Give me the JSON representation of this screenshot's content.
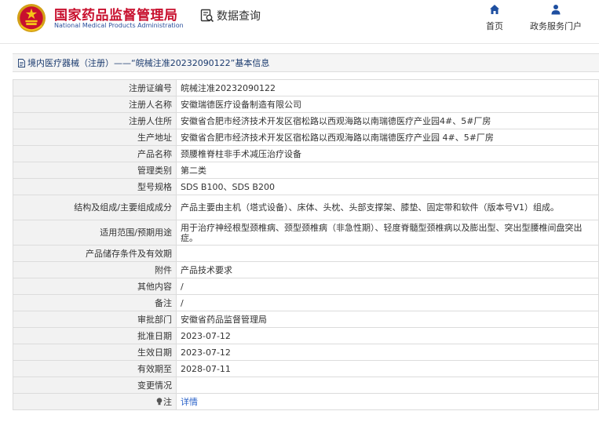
{
  "header": {
    "brand_cn": "国家药品监督管理局",
    "brand_en": "National Medical Products Administration",
    "search_label": "数据查询",
    "nav": [
      {
        "label": "首页",
        "icon": "home-icon"
      },
      {
        "label": "政务服务门户",
        "icon": "user-icon"
      }
    ],
    "colors": {
      "brand_red": "#c8102e",
      "brand_blue": "#2a4f9c",
      "nav_blue": "#1e4fa0"
    }
  },
  "breadcrumb": {
    "icon": "document-icon",
    "text": "境内医疗器械（注册）——“皖械注准20232090122”基本信息"
  },
  "rows": [
    {
      "label": "注册证编号",
      "value": "皖械注准20232090122"
    },
    {
      "label": "注册人名称",
      "value": "安徽瑞德医疗设备制造有限公司"
    },
    {
      "label": "注册人住所",
      "value": "安徽省合肥市经济技术开发区宿松路以西观海路以南瑞德医疗产业园4#、5#厂房"
    },
    {
      "label": "生产地址",
      "value": "安徽省合肥市经济技术开发区宿松路以西观海路以南瑞德医疗产业园 4#、5#厂房"
    },
    {
      "label": "产品名称",
      "value": "颈腰椎脊柱非手术减压治疗设备"
    },
    {
      "label": "管理类别",
      "value": "第二类"
    },
    {
      "label": "型号规格",
      "value": "SDS B100、SDS B200"
    },
    {
      "label": "结构及组成/主要组成成分",
      "value": "产品主要由主机（塔式设备）、床体、头枕、头部支撑架、膝垫、固定带和软件（版本号V1）组成。"
    },
    {
      "label": "适用范围/预期用途",
      "value": "用于治疗神经根型颈椎病、颈型颈椎病（非急性期）、轻度脊髓型颈椎病以及膨出型、突出型腰椎间盘突出症。"
    },
    {
      "label": "产品储存条件及有效期",
      "value": ""
    },
    {
      "label": "附件",
      "value": "产品技术要求"
    },
    {
      "label": "其他内容",
      "value": "/"
    },
    {
      "label": "备注",
      "value": "/"
    },
    {
      "label": "审批部门",
      "value": "安徽省药品监督管理局"
    },
    {
      "label": "批准日期",
      "value": "2023-07-12"
    },
    {
      "label": "生效日期",
      "value": "2023-07-12"
    },
    {
      "label": "有效期至",
      "value": "2028-07-11"
    },
    {
      "label": "变更情况",
      "value": ""
    }
  ],
  "note": {
    "label": "注",
    "icon": "lightbulb-icon",
    "link_text": "详情"
  }
}
